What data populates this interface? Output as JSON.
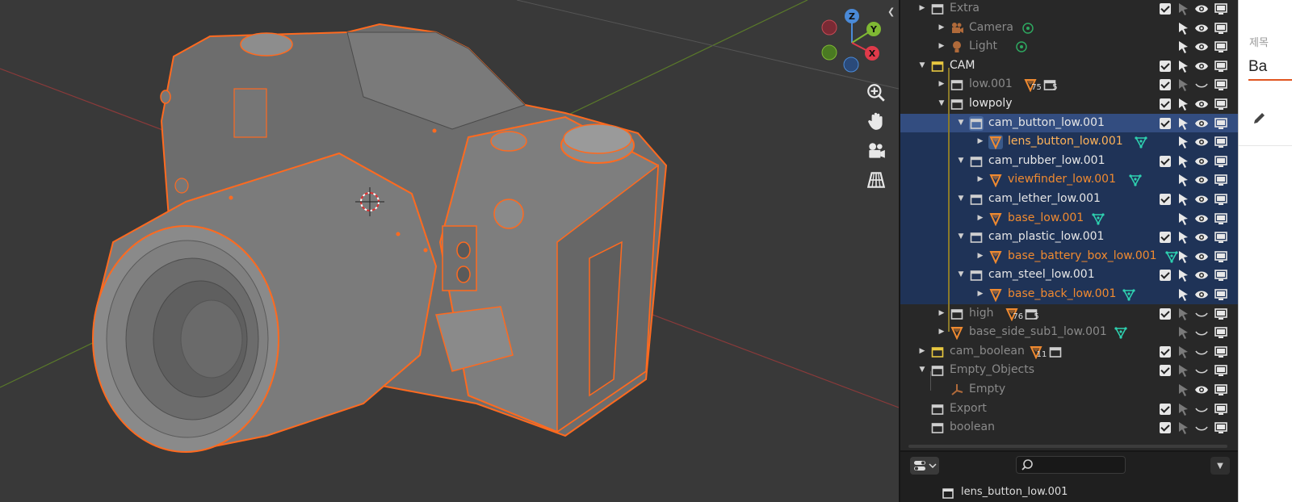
{
  "outliner": {
    "rows": [
      {
        "label": "Extra",
        "kind": "collection",
        "depth": 1,
        "color": "#8a8a8a"
      },
      {
        "label": "Camera",
        "kind": "camera",
        "depth": 2,
        "color": "#8a8a8a"
      },
      {
        "label": "Light",
        "kind": "light",
        "depth": 2,
        "color": "#8a8a8a"
      },
      {
        "label": "CAM",
        "kind": "collection-yellow",
        "depth": 1,
        "color": "#e6e6e6"
      },
      {
        "label": "low.001",
        "kind": "collection",
        "depth": 2,
        "color": "#8a8a8a",
        "badge_a": "75",
        "badge_b": "5"
      },
      {
        "label": "lowpoly",
        "kind": "collection",
        "depth": 2,
        "color": "#e6e6e6"
      },
      {
        "label": "cam_button_low.001",
        "kind": "collection",
        "depth": 3,
        "color": "#e6e6e6"
      },
      {
        "label": "lens_button_low.001",
        "kind": "mesh",
        "depth": 4,
        "color": "#ffb35a"
      },
      {
        "label": "cam_rubber_low.001",
        "kind": "collection",
        "depth": 3,
        "color": "#e6e6e6"
      },
      {
        "label": "viewfinder_low.001",
        "kind": "mesh",
        "depth": 4,
        "color": "#f08a30"
      },
      {
        "label": "cam_lether_low.001",
        "kind": "collection",
        "depth": 3,
        "color": "#e6e6e6"
      },
      {
        "label": "base_low.001",
        "kind": "mesh",
        "depth": 4,
        "color": "#f08a30"
      },
      {
        "label": "cam_plastic_low.001",
        "kind": "collection",
        "depth": 3,
        "color": "#e6e6e6"
      },
      {
        "label": "base_battery_box_low.001",
        "kind": "mesh",
        "depth": 4,
        "color": "#f08a30"
      },
      {
        "label": "cam_steel_low.001",
        "kind": "collection",
        "depth": 3,
        "color": "#e6e6e6"
      },
      {
        "label": "base_back_low.001",
        "kind": "mesh",
        "depth": 4,
        "color": "#f08a30"
      },
      {
        "label": "high",
        "kind": "collection",
        "depth": 2,
        "color": "#8a8a8a",
        "badge_a": "76",
        "badge_b": "5"
      },
      {
        "label": "base_side_sub1_low.001",
        "kind": "mesh",
        "depth": 2,
        "color": "#8a8a8a"
      },
      {
        "label": "cam_boolean",
        "kind": "collection-yellow",
        "depth": 1,
        "color": "#8a8a8a",
        "badge_a": "11"
      },
      {
        "label": "Empty_Objects",
        "kind": "collection",
        "depth": 1,
        "color": "#8a8a8a"
      },
      {
        "label": "Empty",
        "kind": "empty",
        "depth": 2,
        "color": "#8a8a8a"
      },
      {
        "label": "Export",
        "kind": "collection",
        "depth": 1,
        "color": "#8a8a8a"
      },
      {
        "label": "boolean",
        "kind": "collection",
        "depth": 1,
        "color": "#8a8a8a"
      }
    ],
    "bottom_item": "lens_button_low.001"
  },
  "side_panel": {
    "title_fragment": "제목",
    "value_fragment": "Ba"
  },
  "gizmo": {
    "z": "Z",
    "y": "Y",
    "x": "X"
  },
  "colors": {
    "selection": "#334d80",
    "outline": "#ff6a1f",
    "accent": "#e05520"
  }
}
